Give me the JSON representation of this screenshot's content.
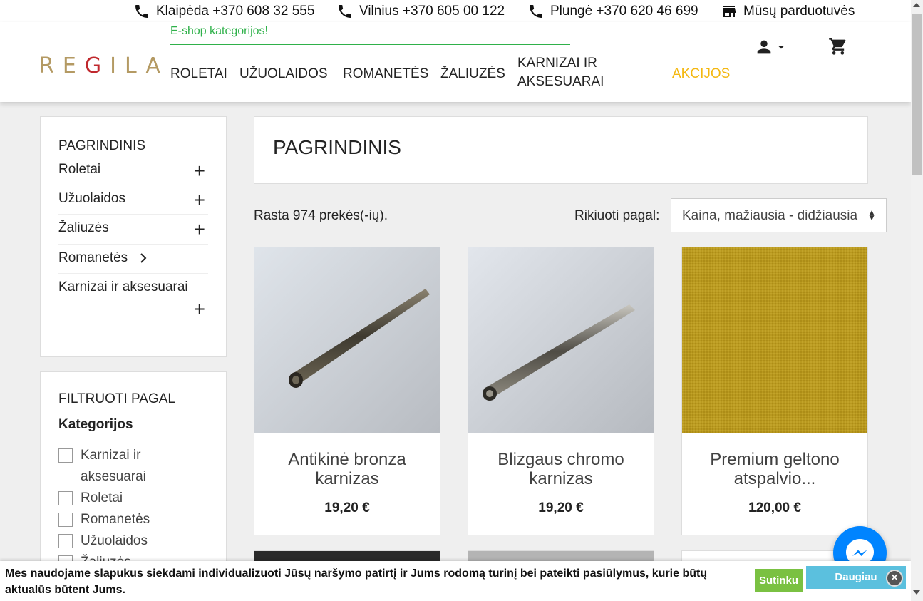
{
  "topbar": {
    "contacts": [
      {
        "label": "Klaipėda +370 608 32 555"
      },
      {
        "label": "Vilnius +370 605 00 122"
      },
      {
        "label": "Plungė +370 620 46 699"
      }
    ],
    "stores_label": "Mūsų parduotuvės"
  },
  "header": {
    "logo": "REGILA",
    "eshop_label": "E-shop kategorijos!",
    "nav": [
      {
        "label": "ROLETAI"
      },
      {
        "label": "UŽUOLAIDOS"
      },
      {
        "label": "ROMANETĖS"
      },
      {
        "label": "ŽALIUZĖS"
      },
      {
        "label": "KARNIZAI IR AKSESUARAI"
      },
      {
        "label": "AKCIJOS"
      }
    ],
    "promo_color": "#f4b70f"
  },
  "sidebar": {
    "title": "PAGRINDINIS",
    "categories": [
      {
        "label": "Roletai",
        "icon": "plus-icon"
      },
      {
        "label": "Užuolaidos",
        "icon": "plus-icon"
      },
      {
        "label": "Žaliuzės",
        "icon": "plus-icon"
      },
      {
        "label": "Romanetės",
        "icon": "chevron-right-icon"
      },
      {
        "label": "Karnizai ir aksesuarai",
        "icon": "plus-icon"
      }
    ],
    "filter_title": "FILTRUOTI PAGAL",
    "filter_group": "Kategorijos",
    "filters": [
      {
        "label": "Karnizai ir aksesuarai"
      },
      {
        "label": "Roletai"
      },
      {
        "label": "Romanetės"
      },
      {
        "label": "Užuolaidos"
      },
      {
        "label": "Žaliuzės"
      }
    ]
  },
  "main": {
    "title": "PAGRINDINIS",
    "count_text": "Rasta 974 prekės(-ių).",
    "sort_label": "Rikiuoti pagal:",
    "sort_value": "Kaina, mažiausia - didžiausia",
    "products": [
      {
        "name": "Antikinė bronza karnizas",
        "price": "19,20 €"
      },
      {
        "name": "Blizgaus chromo karnizas",
        "price": "19,20 €"
      },
      {
        "name": "Premium geltono atspalvio...",
        "price": "120,00 €"
      }
    ]
  },
  "cookie": {
    "text": "Mes naudojame slapukus siekdami individualizuoti Jūsų naršymo patirtį ir Jums rodomą turinį bei pateikti pasiūlymus, kurie būtų aktualūs būtent Jums.",
    "agree_label": "Sutinku",
    "more_label": "Daugiau"
  },
  "colors": {
    "accent_green": "#2fb14a",
    "logo_gold": "#b49a63",
    "logo_red": "#c0282d",
    "messenger_blue": "#0084ff",
    "cookie_agree": "#7ac142",
    "cookie_more": "#5bc0de"
  }
}
